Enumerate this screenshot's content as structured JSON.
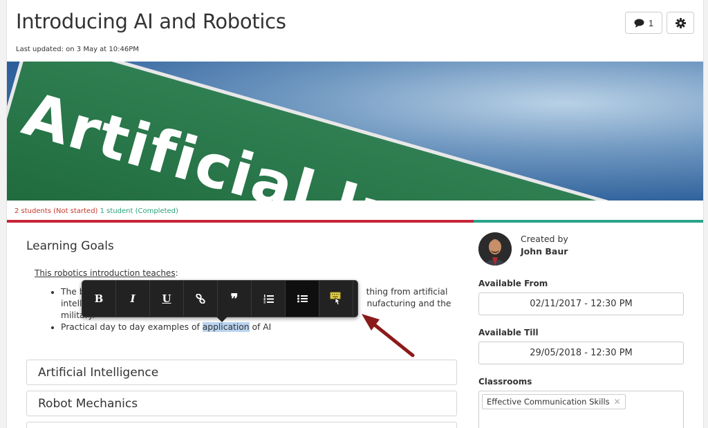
{
  "header": {
    "title": "Introducing AI and Robotics",
    "updated": "Last updated: on 3 May at 10:46PM",
    "comment_count": "1"
  },
  "hero": {
    "sign_text": "Artificial Intelligen"
  },
  "status": {
    "not_started": "2 students (Not started)",
    "completed": "1 student (Completed)",
    "completed_fraction": 0.33
  },
  "content": {
    "heading": "Learning Goals",
    "intro": "This robotics introduction teaches",
    "intro_suffix": ":",
    "bullet1_a": "The b",
    "bullet1_b": "thing from artificial",
    "bullet1_c": "intell",
    "bullet1_d": "nufacturing and the",
    "bullet1_e": "military.",
    "bullet2_pre": "Practical day to day examples of ",
    "bullet2_hl": "application",
    "bullet2_post": " of AI"
  },
  "toolbar": {
    "bold": "B",
    "italic": "I",
    "underline": "U",
    "link_icon": "link-icon",
    "quote": "❞",
    "ordered_list_icon": "ordered-list-icon",
    "unordered_list_icon": "unordered-list-icon",
    "keyboard_icon": "keyboard-icon"
  },
  "sections": [
    "Artificial Intelligence",
    "Robot Mechanics",
    ""
  ],
  "sidebar": {
    "created_by": "Created by",
    "creator": "John Baur",
    "available_from_label": "Available From",
    "available_from": "02/11/2017 - 12:30 PM",
    "available_till_label": "Available Till",
    "available_till": "29/05/2018 - 12:30 PM",
    "classrooms_label": "Classrooms",
    "classroom_chip": "Effective Communication Skills"
  },
  "colors": {
    "progress_red": "#c62336",
    "progress_green": "#2aa38a",
    "arrow": "#8b1a1a"
  }
}
